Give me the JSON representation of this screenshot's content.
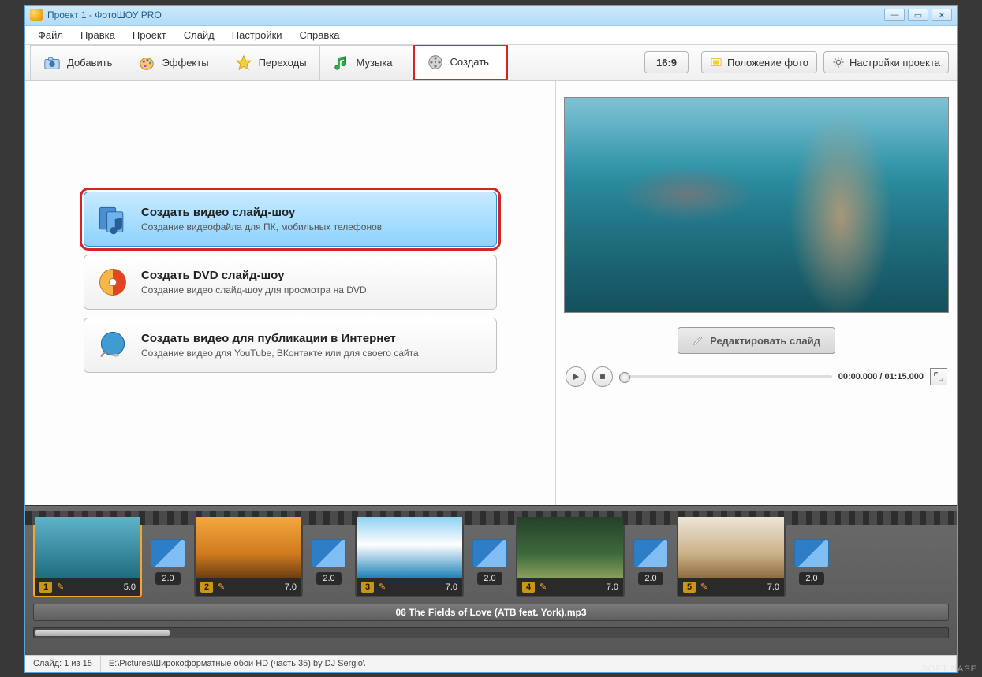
{
  "titlebar": {
    "title": "Проект 1 - ФотоШОУ PRO"
  },
  "menu": {
    "items": [
      "Файл",
      "Правка",
      "Проект",
      "Слайд",
      "Настройки",
      "Справка"
    ]
  },
  "tabs": {
    "items": [
      {
        "label": "Добавить"
      },
      {
        "label": "Эффекты"
      },
      {
        "label": "Переходы"
      },
      {
        "label": "Музыка"
      },
      {
        "label": "Создать"
      }
    ]
  },
  "right_toolbar": {
    "aspect": "16:9",
    "photo_pos": "Положение фото",
    "proj_settings": "Настройки проекта"
  },
  "create_options": [
    {
      "title": "Создать видео слайд-шоу",
      "desc": "Создание видеофайла для ПК, мобильных телефонов"
    },
    {
      "title": "Создать DVD слайд-шоу",
      "desc": "Создание видео слайд-шоу для просмотра на DVD"
    },
    {
      "title": "Создать видео для публикации в Интернет",
      "desc": "Создание видео для YouTube, ВКонтакте или для своего сайта"
    }
  ],
  "preview": {
    "edit_label": "Редактировать слайд",
    "time": "00:00.000 / 01:15.000"
  },
  "timeline": {
    "slides": [
      {
        "n": "1",
        "dur": "5.0"
      },
      {
        "n": "2",
        "dur": "7.0"
      },
      {
        "n": "3",
        "dur": "7.0"
      },
      {
        "n": "4",
        "dur": "7.0"
      },
      {
        "n": "5",
        "dur": "7.0"
      }
    ],
    "transitions": [
      "2.0",
      "2.0",
      "2.0",
      "2.0",
      "2.0"
    ],
    "audio": "06 The Fields of Love (ATB feat. York).mp3"
  },
  "statusbar": {
    "slide": "Слайд: 1 из 15",
    "path": "E:\\Pictures\\Широкоформатные обои HD (часть 35) by DJ Sergio\\"
  },
  "watermark": "SOFT BASE"
}
